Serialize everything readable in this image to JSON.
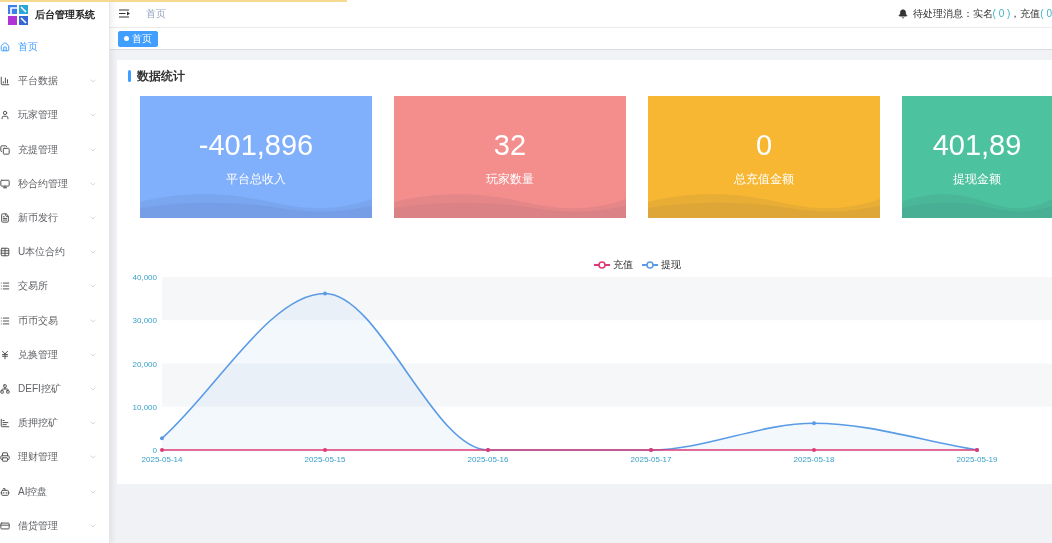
{
  "loading_bar": {
    "level": 0.33
  },
  "sidebar": {
    "logo_text": "后台管理系统",
    "items": [
      {
        "label": "首页",
        "kind": "link",
        "selected": true
      },
      {
        "label": "平台数据",
        "kind": "submenu",
        "selected": false,
        "expanded": false
      },
      {
        "label": "玩家管理",
        "kind": "submenu",
        "selected": false,
        "expanded": false
      },
      {
        "label": "充提管理",
        "kind": "submenu",
        "selected": false,
        "expanded": false
      },
      {
        "label": "秒合约管理",
        "kind": "submenu",
        "selected": false,
        "expanded": false
      },
      {
        "label": "新币发行",
        "kind": "submenu",
        "selected": false,
        "expanded": false
      },
      {
        "label": "U本位合约",
        "kind": "submenu",
        "selected": false,
        "expanded": false
      },
      {
        "label": "交易所",
        "kind": "submenu",
        "selected": false,
        "expanded": false
      },
      {
        "label": "币币交易",
        "kind": "submenu",
        "selected": false,
        "expanded": false
      },
      {
        "label": "兑换管理",
        "kind": "submenu",
        "selected": false,
        "expanded": false
      },
      {
        "label": "DEFI挖矿",
        "kind": "submenu",
        "selected": false,
        "expanded": false
      },
      {
        "label": "质押挖矿",
        "kind": "submenu",
        "selected": false,
        "expanded": false
      },
      {
        "label": "理财管理",
        "kind": "submenu",
        "selected": false,
        "expanded": false
      },
      {
        "label": "AI控盘",
        "kind": "submenu",
        "selected": false,
        "expanded": false
      },
      {
        "label": "借贷管理",
        "kind": "submenu",
        "selected": false,
        "expanded": false
      }
    ]
  },
  "header": {
    "breadcrumb": [
      "首页"
    ],
    "notice": {
      "label": "待处理消息：",
      "counts": [
        {
          "name": "实名",
          "value": "( 0 )"
        },
        {
          "name": "，充值",
          "value": "( 0"
        }
      ]
    }
  },
  "tags": [
    {
      "label": "首页",
      "selected": true
    }
  ],
  "panel": {
    "title": "数据统计",
    "cards": [
      {
        "value": "-401,896",
        "label": "平台总收入",
        "color": "#80affb"
      },
      {
        "value": "32",
        "label": "玩家数量",
        "color": "#f48e8d"
      },
      {
        "value": "0",
        "label": "总充值金额",
        "color": "#f7b733"
      },
      {
        "value": "401,89",
        "label": "提现金额",
        "color": "#4dc29e"
      }
    ],
    "chart_data": {
      "type": "line",
      "legend": "top",
      "categories": [
        "2025-05-14",
        "2025-05-15",
        "2025-05-16",
        "2025-05-17",
        "2025-05-18",
        "2025-05-19"
      ],
      "series": [
        {
          "name": "充值",
          "color": "#dd3a76",
          "values": [
            0,
            0,
            0,
            0,
            0,
            0
          ]
        },
        {
          "name": "提现",
          "color": "#5a9be6",
          "values": [
            2700,
            36200,
            0,
            0,
            6200,
            0
          ]
        }
      ],
      "ylim": [
        0,
        40000
      ],
      "yticks": [
        {
          "value": 0,
          "label": "0"
        },
        {
          "value": 10000,
          "label": "10,000"
        },
        {
          "value": 20000,
          "label": "20,000"
        },
        {
          "value": 30000,
          "label": "30,000"
        },
        {
          "value": 40000,
          "label": "40,000"
        }
      ]
    }
  }
}
